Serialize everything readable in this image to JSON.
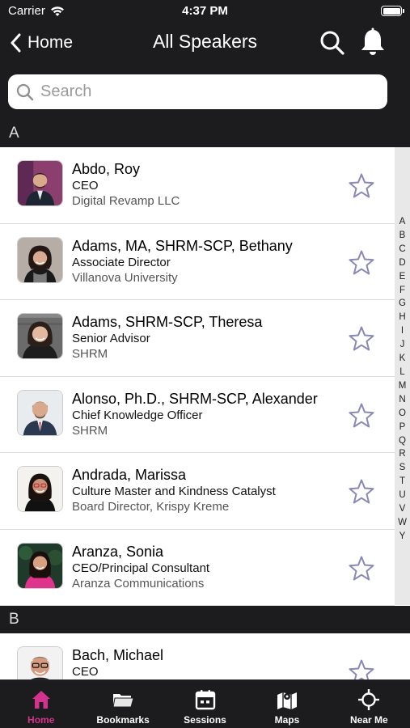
{
  "status": {
    "carrier": "Carrier",
    "time": "4:37 PM",
    "battery_level": 1.0
  },
  "nav": {
    "back_label": "Home",
    "title": "All Speakers"
  },
  "search": {
    "placeholder": "Search",
    "value": ""
  },
  "sections": [
    {
      "letter": "A",
      "speakers": [
        {
          "name": "Abdo, Roy",
          "title": "CEO",
          "org": "Digital Revamp LLC"
        },
        {
          "name": "Adams, MA, SHRM-SCP, Bethany",
          "title": "Associate Director",
          "org": "Villanova University"
        },
        {
          "name": "Adams, SHRM-SCP, Theresa",
          "title": "Senior Advisor",
          "org": "SHRM"
        },
        {
          "name": "Alonso, Ph.D., SHRM-SCP, Alexander",
          "title": "Chief Knowledge Officer",
          "org": "SHRM"
        },
        {
          "name": "Andrada, Marissa",
          "title": "Culture Master and Kindness Catalyst",
          "org": "Board Director, Krispy Kreme"
        },
        {
          "name": "Aranza, Sonia",
          "title": "CEO/Principal Consultant",
          "org": "Aranza Communications"
        }
      ]
    },
    {
      "letter": "B",
      "speakers": [
        {
          "name": "Bach, Michael",
          "title": "CEO",
          "org": ""
        }
      ]
    }
  ],
  "index_letters": [
    "A",
    "B",
    "C",
    "D",
    "E",
    "F",
    "G",
    "H",
    "I",
    "J",
    "K",
    "L",
    "M",
    "N",
    "O",
    "P",
    "Q",
    "R",
    "S",
    "T",
    "U",
    "V",
    "W",
    "Y"
  ],
  "tabs": [
    {
      "label": "Home",
      "icon": "home-icon",
      "active": true
    },
    {
      "label": "Bookmarks",
      "icon": "folder-icon",
      "active": false
    },
    {
      "label": "Sessions",
      "icon": "calendar-icon",
      "active": false
    },
    {
      "label": "Maps",
      "icon": "map-icon",
      "active": false
    },
    {
      "label": "Near Me",
      "icon": "crosshair-icon",
      "active": false
    }
  ],
  "colors": {
    "background": "#1c1c1e",
    "accent": "#d3338f",
    "star": "#8a88b8"
  }
}
